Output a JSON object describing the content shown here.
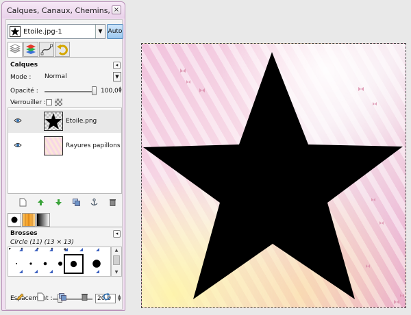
{
  "window": {
    "title": "Calques, Canaux, Chemins, ..."
  },
  "image_selector": {
    "selected": "Etoile.jpg-1",
    "auto_label": "Auto"
  },
  "layers_panel": {
    "title": "Calques",
    "mode_label": "Mode :",
    "mode_value": "Normal",
    "opacity_label": "Opacité :",
    "opacity_value": "100,0",
    "lock_label": "Verrouiller :",
    "layers": [
      {
        "name": "Etoile.png",
        "visible": true,
        "selected": true
      },
      {
        "name": "Rayures papillons",
        "visible": true,
        "selected": false
      }
    ]
  },
  "brushes_panel": {
    "title": "Brosses",
    "selected_brush": "Circle (11) (13 × 13)",
    "spacing_label": "Espacement :",
    "spacing_value": "20,0"
  },
  "icons": {
    "close": "close-icon",
    "panel_menu": "tab-menu-icon",
    "eye": "eye-icon"
  },
  "colors": {
    "dock_frame": "#f0dff0",
    "auto_button": "#9cc9f0",
    "star_fill": "#000000"
  }
}
